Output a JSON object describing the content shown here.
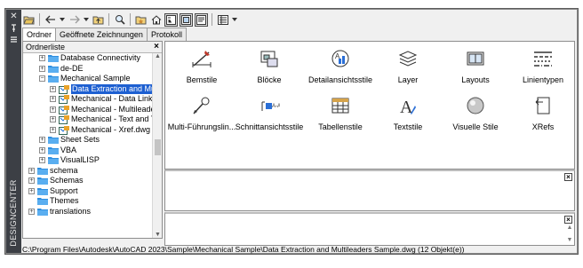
{
  "window": {
    "title_vertical": "DESIGNCENTER",
    "controls": [
      "close-icon",
      "pin-icon",
      "properties-icon"
    ]
  },
  "toolbar": {
    "buttons": [
      "load-icon",
      "back-icon",
      "forward-icon",
      "up-icon",
      "search-icon",
      "favorites-icon",
      "home-icon",
      "tree-view-icon",
      "preview-icon",
      "description-icon",
      "views-icon"
    ]
  },
  "tabs": [
    {
      "label": "Ordner",
      "active": true
    },
    {
      "label": "Geöffnete Zeichnungen",
      "active": false
    },
    {
      "label": "Protokoll",
      "active": false
    }
  ],
  "tree": {
    "header": "Ordnerliste",
    "close": "×",
    "items": [
      {
        "label": "Database Connectivity",
        "level": 1,
        "expander": "+",
        "icon": "folder-icon"
      },
      {
        "label": "de-DE",
        "level": 1,
        "expander": "+",
        "icon": "folder-icon"
      },
      {
        "label": "Mechanical Sample",
        "level": 1,
        "expander": "−",
        "icon": "folder-icon"
      },
      {
        "label": "Data Extraction and Mult",
        "level": 2,
        "expander": "+",
        "icon": "dwg-icon",
        "selected": true
      },
      {
        "label": "Mechanical - Data Links.",
        "level": 2,
        "expander": "+",
        "icon": "dwg-icon"
      },
      {
        "label": "Mechanical - Multileader",
        "level": 2,
        "expander": "+",
        "icon": "dwg-icon"
      },
      {
        "label": "Mechanical - Text and Ta",
        "level": 2,
        "expander": "+",
        "icon": "dwg-icon"
      },
      {
        "label": "Mechanical - Xref.dwg",
        "level": 2,
        "expander": "+",
        "icon": "dwg-icon"
      },
      {
        "label": "Sheet Sets",
        "level": 1,
        "expander": "+",
        "icon": "folder-icon"
      },
      {
        "label": "VBA",
        "level": 1,
        "expander": "+",
        "icon": "folder-icon"
      },
      {
        "label": "VisualLISP",
        "level": 1,
        "expander": "+",
        "icon": "folder-icon"
      },
      {
        "label": "schema",
        "level": 0,
        "expander": "+",
        "icon": "folder-icon"
      },
      {
        "label": "Schemas",
        "level": 0,
        "expander": "+",
        "icon": "folder-icon"
      },
      {
        "label": "Support",
        "level": 0,
        "expander": "+",
        "icon": "folder-icon"
      },
      {
        "label": "Themes",
        "level": 0,
        "expander": "",
        "icon": "folder-icon"
      },
      {
        "label": "translations",
        "level": 0,
        "expander": "+",
        "icon": "folder-icon"
      }
    ]
  },
  "content": {
    "items": [
      {
        "label": "Bemstile",
        "icon": "dimension-style-icon"
      },
      {
        "label": "Blöcke",
        "icon": "blocks-icon"
      },
      {
        "label": "Detailansichtsstile",
        "icon": "detail-view-style-icon"
      },
      {
        "label": "Layer",
        "icon": "layers-icon"
      },
      {
        "label": "Layouts",
        "icon": "layouts-icon"
      },
      {
        "label": "Linientypen",
        "icon": "linetypes-icon"
      },
      {
        "label": "Multi-Führungslin...",
        "icon": "multileader-style-icon"
      },
      {
        "label": "Schnittansichtsstile",
        "icon": "section-view-style-icon"
      },
      {
        "label": "Tabellenstile",
        "icon": "table-style-icon"
      },
      {
        "label": "Textstile",
        "icon": "text-style-icon"
      },
      {
        "label": "Visuelle Stile",
        "icon": "visual-style-icon"
      },
      {
        "label": "XRefs",
        "icon": "xrefs-icon"
      }
    ]
  },
  "preview_close": "×",
  "description_close": "×",
  "status": "C:\\Program Files\\Autodesk\\AutoCAD 2023\\Sample\\Mechanical Sample\\Data Extraction and Multileaders Sample.dwg (12 Objekt(e))",
  "colors": {
    "selection": "#1d5fd1",
    "titlebar": "#3c3f45",
    "folder": "#2f8fe0"
  }
}
